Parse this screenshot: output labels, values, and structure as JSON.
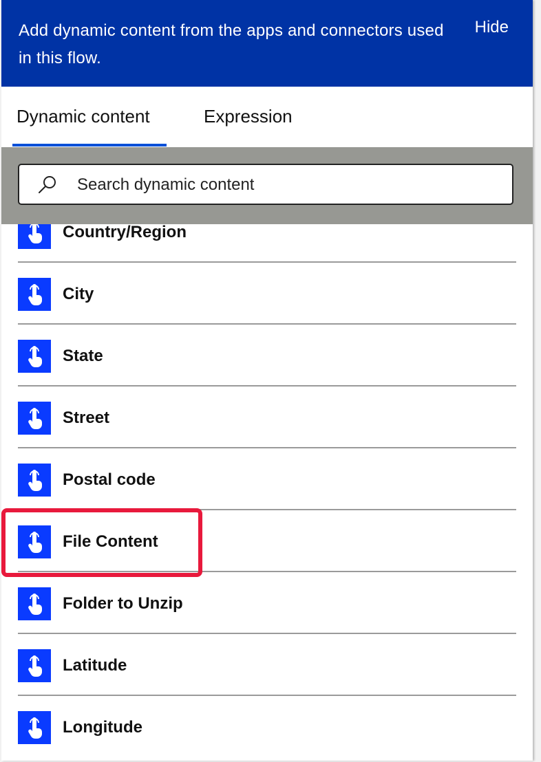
{
  "banner": {
    "text": "Add dynamic content from the apps and connectors used in this flow.",
    "hide_label": "Hide"
  },
  "tabs": [
    {
      "label": "Dynamic content",
      "active": true
    },
    {
      "label": "Expression",
      "active": false
    }
  ],
  "search": {
    "placeholder": "Search dynamic content",
    "value": ""
  },
  "items": [
    {
      "label": "Country/Region",
      "icon": "touch-hand-icon"
    },
    {
      "label": "City",
      "icon": "touch-hand-icon"
    },
    {
      "label": "State",
      "icon": "touch-hand-icon"
    },
    {
      "label": "Street",
      "icon": "touch-hand-icon"
    },
    {
      "label": "Postal code",
      "icon": "touch-hand-icon"
    },
    {
      "label": "File Content",
      "icon": "touch-hand-icon",
      "highlighted": true
    },
    {
      "label": "Folder to Unzip",
      "icon": "touch-hand-icon"
    },
    {
      "label": "Latitude",
      "icon": "touch-hand-icon"
    },
    {
      "label": "Longitude",
      "icon": "touch-hand-icon"
    }
  ],
  "colors": {
    "banner": "#0033a5",
    "tab_underline": "#0050d8",
    "icon_bg": "#0a3bff",
    "highlight": "#e8193c"
  }
}
